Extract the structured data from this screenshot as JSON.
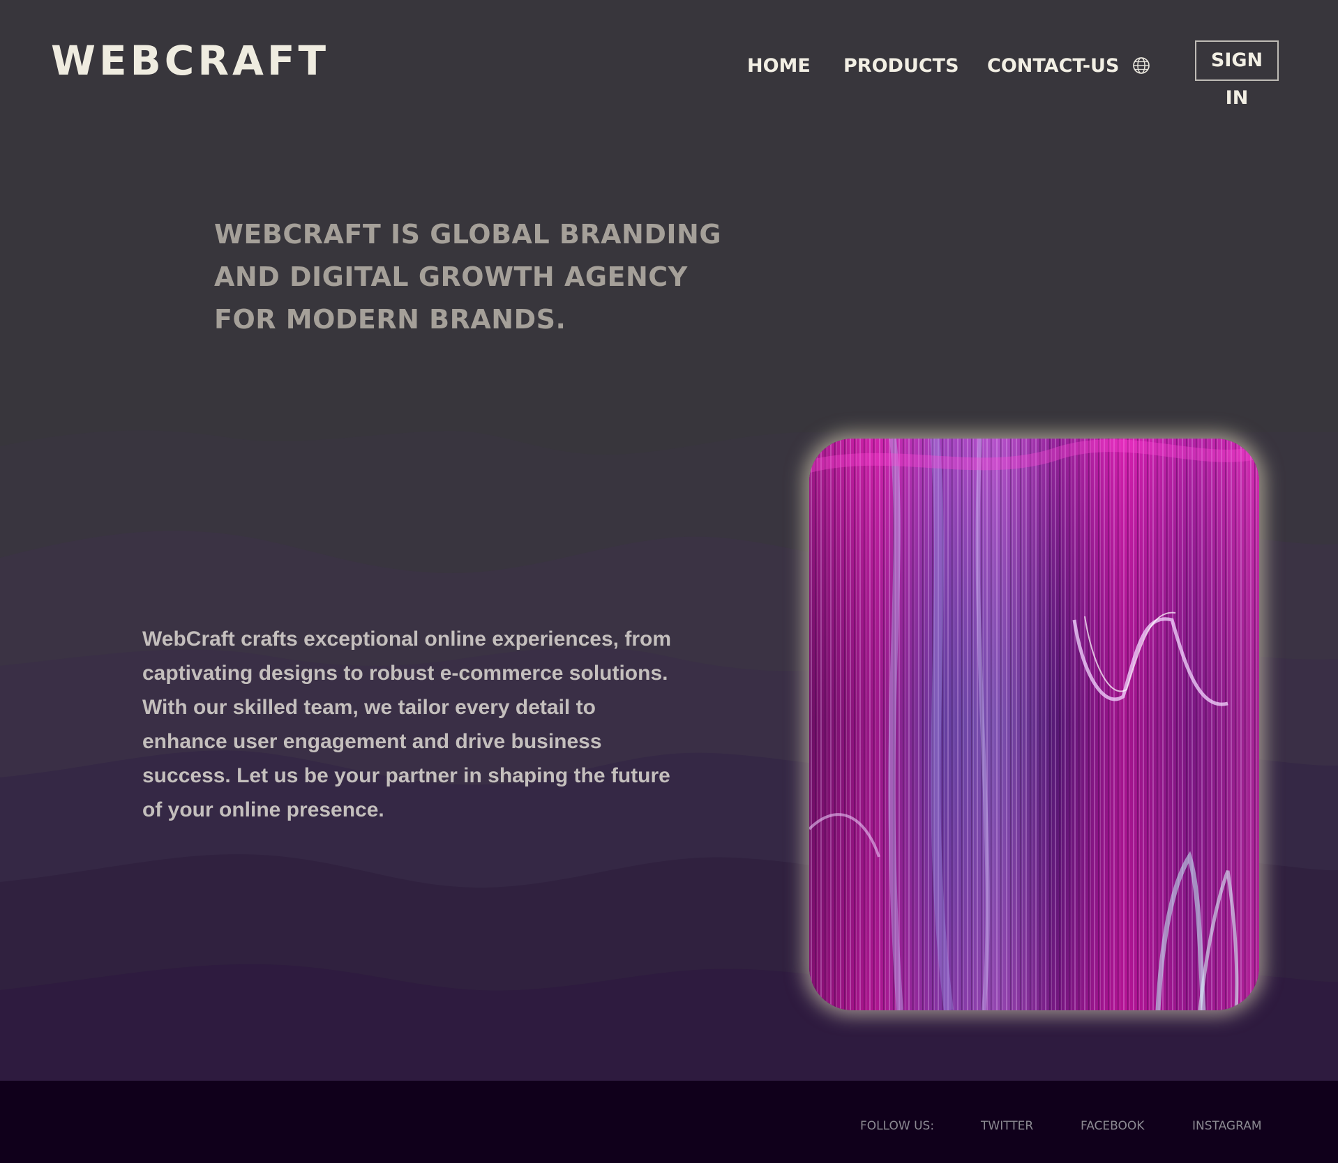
{
  "brand": {
    "logo_text": "WEBCRAFT"
  },
  "nav": {
    "items": [
      {
        "label": "HOME"
      },
      {
        "label": "PRODUCTS"
      },
      {
        "label": "CONTACT-US"
      }
    ],
    "language_icon": "globe-icon",
    "signin_label": "SIGN IN"
  },
  "hero": {
    "headline": "WEBCRAFT IS GLOBAL BRANDING AND DIGITAL GROWTH AGENCY FOR MODERN BRANDS.",
    "description": "WebCraft crafts exceptional online experiences, from captivating designs to robust e-commerce solutions. With our skilled team, we tailor every detail to enhance user engagement and drive business success. Let us be your partner in shaping the future of your online presence."
  },
  "footer": {
    "follow_label": "FOLLOW US:",
    "links": [
      {
        "label": "TWITTER"
      },
      {
        "label": "FACEBOOK"
      },
      {
        "label": "INSTAGRAM"
      }
    ]
  },
  "colors": {
    "background": "#38363c",
    "text_light": "#f2efe4",
    "headline": "#a5a099",
    "footer_bg": "#10001b",
    "accent_magenta": "#b8158f",
    "accent_violet": "#6a3fa8"
  }
}
